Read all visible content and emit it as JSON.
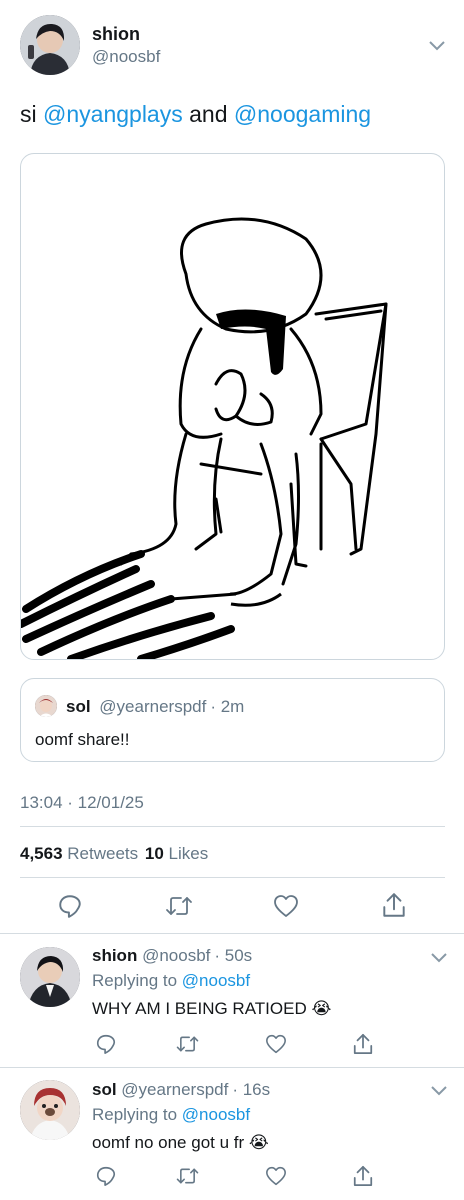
{
  "tweet": {
    "author_name": "shion",
    "author_handle": "@noosbf",
    "text_prefix": "si",
    "mention_1": "@nyangplays",
    "text_and": "and",
    "mention_2": "@noogaming",
    "timestamp": "13:04 · 12/01/25",
    "retweets_count": "4,563",
    "retweets_label": "Retweets",
    "likes_count": "10",
    "likes_label": "Likes"
  },
  "quote": {
    "author_name": "sol",
    "author_handle": "@yearnerspdf",
    "time": "· 2m",
    "text": "oomf share!!"
  },
  "replies": [
    {
      "author_name": "shion",
      "author_handle": "@noosbf",
      "time": "· 50s",
      "replying_prefix": "Replying to",
      "replying_to": "@noosbf",
      "text": "WHY AM I BEING RATIOED",
      "emoji": "😭"
    },
    {
      "author_name": "sol",
      "author_handle": "@yearnerspdf",
      "time": "· 16s",
      "replying_prefix": "Replying to",
      "replying_to": "@noosbf",
      "text": "oomf no one got u fr",
      "emoji": "😭"
    }
  ],
  "icons": {
    "reply": "reply-icon",
    "retweet": "retweet-icon",
    "like": "like-icon",
    "share": "share-icon",
    "more": "chevron-down-icon"
  },
  "colors": {
    "link": "#1b95e0",
    "secondary_text": "#657786",
    "divider": "#d5dce1"
  }
}
